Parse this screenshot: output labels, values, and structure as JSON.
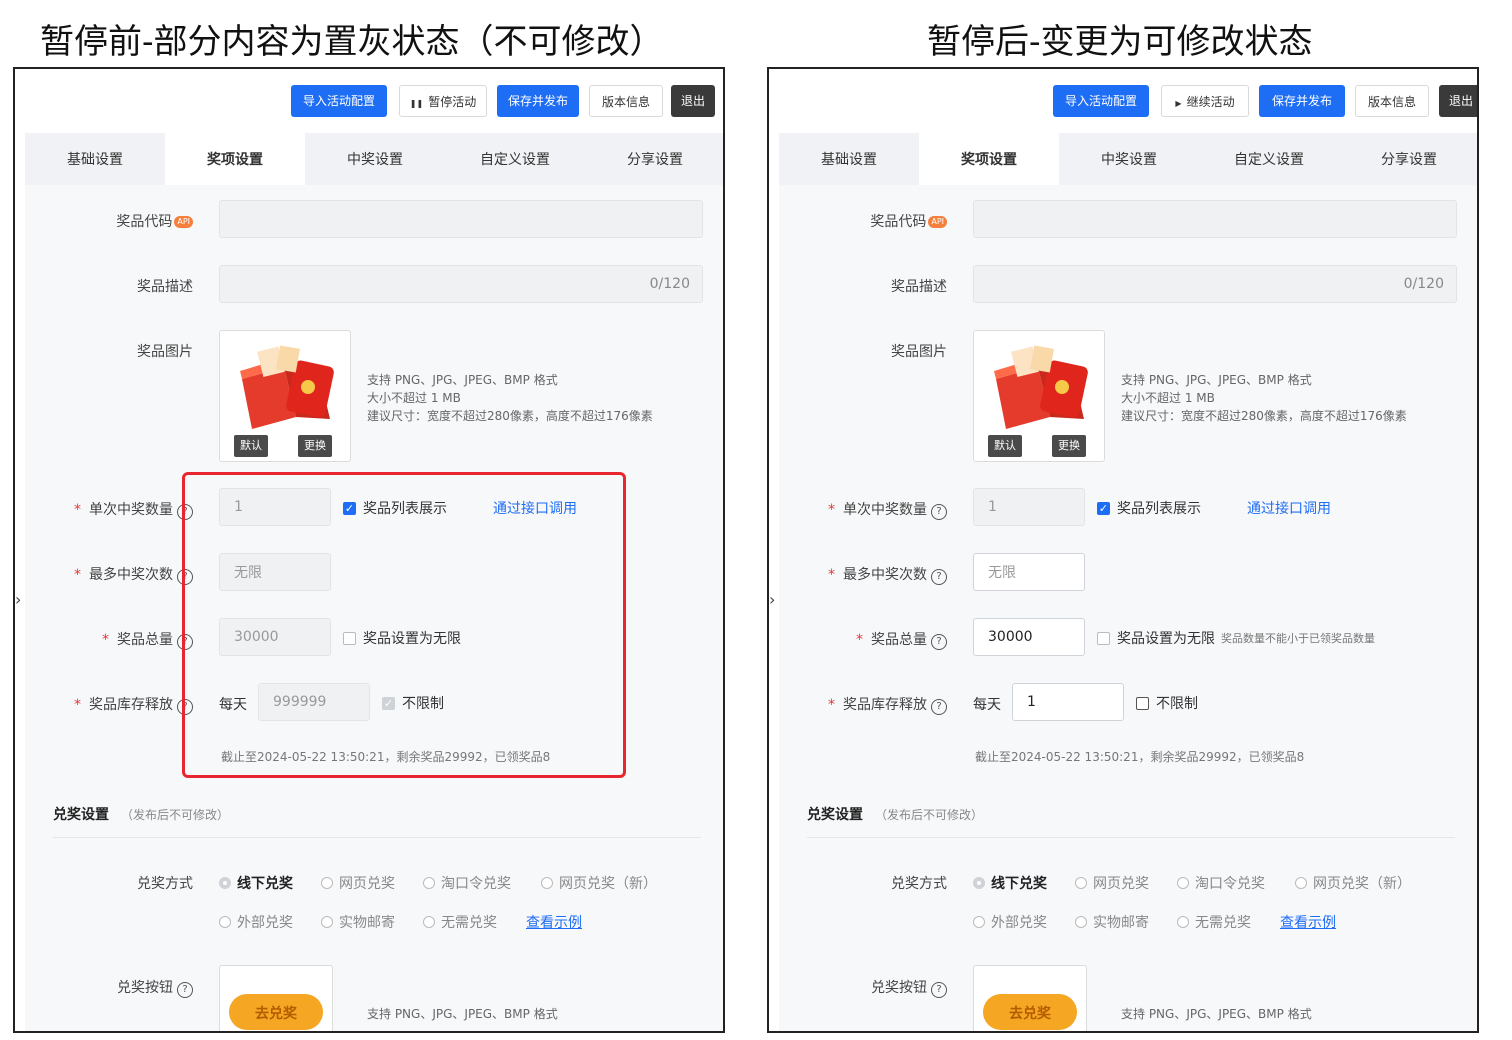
{
  "captions": {
    "left": "暂停前-部分内容为置灰状态（不可修改）",
    "right": "暂停后-变更为可修改状态"
  },
  "left": {
    "toolbar": {
      "import": "导入活动配置",
      "toggle_icon": "pause-icon",
      "toggle": "暂停活动",
      "save": "保存并发布",
      "version": "版本信息",
      "exit": "退出"
    },
    "tabs": [
      "基础设置",
      "奖项设置",
      "中奖设置",
      "自定义设置",
      "分享设置"
    ],
    "active_tab": "奖项设置",
    "form": {
      "prize_code_label": "奖品代码",
      "api_badge": "API",
      "prize_desc_label": "奖品描述",
      "prize_desc_counter": "0/120",
      "prize_image_label": "奖品图片",
      "image_default": "默认",
      "image_replace": "更换",
      "image_hint": [
        "支持 PNG、JPG、JPEG、BMP 格式",
        "大小不超过 1 MB",
        "建议尺寸：宽度不超过280像素，高度不超过176像素"
      ],
      "single_win_label": "单次中奖数量",
      "single_win_value": "1",
      "list_display": "奖品列表展示",
      "api_call": "通过接口调用",
      "max_win_label": "最多中奖次数",
      "max_win_value": "无限",
      "total_label": "奖品总量",
      "total_value": "30000",
      "unlimited_label": "奖品设置为无限",
      "unlimited_note": "",
      "release_label": "奖品库存释放",
      "per_day": "每天",
      "release_value": "999999",
      "no_limit": "不限制",
      "stock_status": "截止至2024-05-22 13:50:21，剩余奖品29992，已领奖品8",
      "redeem_section": "兑奖设置",
      "redeem_note": "（发布后不可修改）",
      "redeem_method_label": "兑奖方式",
      "redeem_options_row1": [
        "线下兑奖",
        "网页兑奖",
        "淘口令兑奖",
        "网页兑奖（新）"
      ],
      "redeem_options_row2": [
        "外部兑奖",
        "实物邮寄",
        "无需兑奖"
      ],
      "view_example": "查看示例",
      "redeem_button_label": "兑奖按钮",
      "redeem_button_text": "去兑奖",
      "redeem_button_hint": "支持 PNG、JPG、JPEG、BMP 格式"
    }
  },
  "right": {
    "toolbar": {
      "import": "导入活动配置",
      "toggle_icon": "play-icon",
      "toggle": "继续活动",
      "save": "保存并发布",
      "version": "版本信息",
      "exit": "退出"
    },
    "tabs": [
      "基础设置",
      "奖项设置",
      "中奖设置",
      "自定义设置",
      "分享设置"
    ],
    "active_tab": "奖项设置",
    "form": {
      "prize_code_label": "奖品代码",
      "api_badge": "API",
      "prize_desc_label": "奖品描述",
      "prize_desc_counter": "0/120",
      "prize_image_label": "奖品图片",
      "image_default": "默认",
      "image_replace": "更换",
      "image_hint": [
        "支持 PNG、JPG、JPEG、BMP 格式",
        "大小不超过 1 MB",
        "建议尺寸：宽度不超过280像素，高度不超过176像素"
      ],
      "single_win_label": "单次中奖数量",
      "single_win_value": "1",
      "list_display": "奖品列表展示",
      "api_call": "通过接口调用",
      "max_win_label": "最多中奖次数",
      "max_win_value": "无限",
      "total_label": "奖品总量",
      "total_value": "30000",
      "unlimited_label": "奖品设置为无限",
      "unlimited_note": "奖品数量不能小于已领奖品数量",
      "release_label": "奖品库存释放",
      "per_day": "每天",
      "release_value": "1",
      "no_limit": "不限制",
      "stock_status": "截止至2024-05-22 13:50:21，剩余奖品29992，已领奖品8",
      "redeem_section": "兑奖设置",
      "redeem_note": "（发布后不可修改）",
      "redeem_method_label": "兑奖方式",
      "redeem_options_row1": [
        "线下兑奖",
        "网页兑奖",
        "淘口令兑奖",
        "网页兑奖（新）"
      ],
      "redeem_options_row2": [
        "外部兑奖",
        "实物邮寄",
        "无需兑奖"
      ],
      "view_example": "查看示例",
      "redeem_button_label": "兑奖按钮",
      "redeem_button_text": "去兑奖",
      "redeem_button_hint": "支持 PNG、JPG、JPEG、BMP 格式"
    }
  },
  "colors": {
    "primary": "#1e6df5",
    "highlight_border": "#e8262f",
    "disabled_bg": "#f0f1f3"
  }
}
